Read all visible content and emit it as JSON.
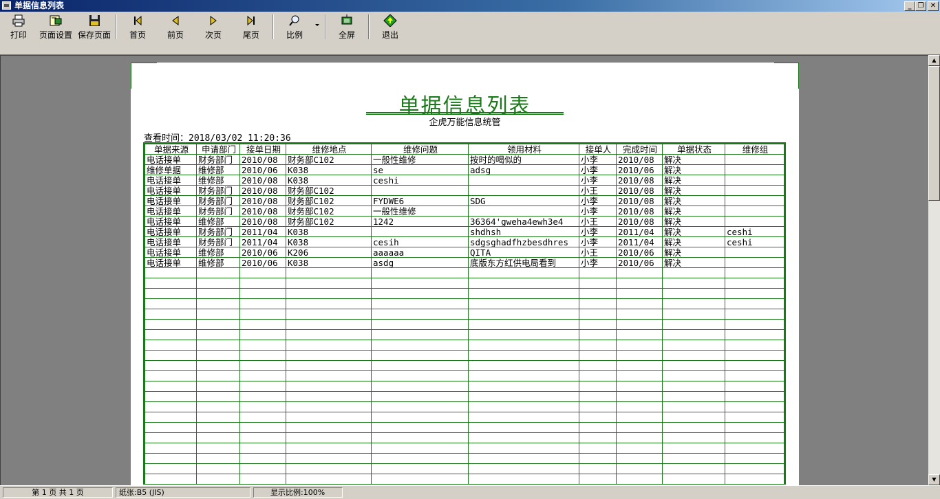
{
  "window": {
    "title": "单据信息列表",
    "controls": [
      "_",
      "❐",
      "✕"
    ]
  },
  "toolbar": {
    "print": "打印",
    "page_setup": "页面设置",
    "save_page": "保存页面",
    "first_page": "首页",
    "prev_page": "前页",
    "next_page": "次页",
    "last_page": "尾页",
    "zoom": "比例",
    "fullscreen": "全屏",
    "exit": "退出"
  },
  "report": {
    "title": "单据信息列表",
    "subtitle": "企虎万能信息统管",
    "view_time": "查看时间：2018/03/02 11:20:36",
    "columns": [
      "单据来源",
      "申请部门",
      "接单日期",
      "维修地点",
      "维修问题",
      "领用材料",
      "接单人",
      "完成时间",
      "单据状态",
      "维修组"
    ],
    "rows": [
      [
        "电话接单",
        "财务部门",
        "2010/08",
        "财务部C102",
        "一般性维修",
        "按时的喝似的",
        "小李",
        "2010/08",
        "解决",
        ""
      ],
      [
        "维修单据",
        "维修部",
        "2010/06",
        "K038",
        "se",
        "adsg",
        "小李",
        "2010/06",
        "解决",
        ""
      ],
      [
        "电话接单",
        "维修部",
        "2010/08",
        "K038",
        "ceshi",
        "",
        "小李",
        "2010/08",
        "解决",
        ""
      ],
      [
        "电话接单",
        "财务部门",
        "2010/08",
        "财务部C102",
        "",
        "",
        "小王",
        "2010/08",
        "解决",
        ""
      ],
      [
        "电话接单",
        "财务部门",
        "2010/08",
        "财务部C102",
        "FYDWE6",
        "SDG",
        "小李",
        "2010/08",
        "解决",
        ""
      ],
      [
        "电话接单",
        "财务部门",
        "2010/08",
        "财务部C102",
        "一般性维修",
        "",
        "小李",
        "2010/08",
        "解决",
        ""
      ],
      [
        "电话接单",
        "维修部",
        "2010/08",
        "财务部C102",
        "1242",
        "36364'gweha4ewh3e4",
        "小王",
        "2010/08",
        "解决",
        ""
      ],
      [
        "电话接单",
        "财务部门",
        "2011/04",
        "K038",
        "",
        "shdhsh",
        "小李",
        "2011/04",
        "解决",
        "ceshi"
      ],
      [
        "电话接单",
        "财务部门",
        "2011/04",
        "K038",
        "cesih",
        "sdgsghadfhzbesdhres",
        "小李",
        "2011/04",
        "解决",
        "ceshi"
      ],
      [
        "电话接单",
        "维修部",
        "2010/06",
        "K206",
        "aaaaaa",
        "QITA",
        "小王",
        "2010/06",
        "解决",
        ""
      ],
      [
        "电话接单",
        "维修部",
        "2010/06",
        "K038",
        "asdg",
        "底版东方红供电局看到",
        "小李",
        "2010/06",
        "解决",
        ""
      ]
    ]
  },
  "status": {
    "page": "第 1 页 共 1 页",
    "paper": "纸张:B5 (JIS)",
    "zoom": "显示比例:100%"
  },
  "colors": {
    "report_green": "#1a7a1a",
    "titlebar": "#0a246a"
  }
}
